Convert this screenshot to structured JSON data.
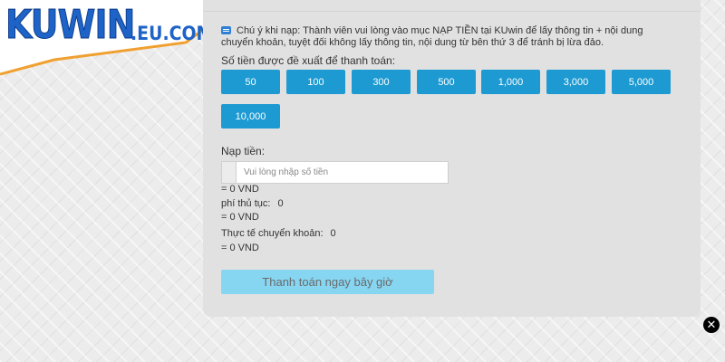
{
  "brand": {
    "name": "KUWIN",
    "suffix": ".EU.COM"
  },
  "notice": {
    "icon": "info-icon",
    "text": "Chú ý khi nạp: Thành viên vui lòng vào mục NẠP TIỀN tại KUwin để lấy thông tin + nội dung chuyển khoản, tuyệt đối không lấy thông tin, nội dung từ bên thứ 3 để tránh bị lừa đảo."
  },
  "suggested": {
    "label": "Số tiền được đề xuất để thanh toán:",
    "amounts": [
      "50",
      "100",
      "300",
      "500",
      "1,000",
      "3,000",
      "5,000",
      "10,000"
    ]
  },
  "deposit": {
    "label": "Nạp tiền:",
    "placeholder": "Vui lòng nhập số tiền",
    "value": ""
  },
  "summary": {
    "amount_vnd": "= 0 VND",
    "fee_label": "phí thủ tục:",
    "fee_value": "0",
    "fee_vnd": "= 0 VND",
    "actual_label": "Thực tế chuyển khoản:",
    "actual_value": "0",
    "actual_vnd": "= 0 VND"
  },
  "pay_button": "Thanh toán ngay bây giờ",
  "close_icon": "close-icon",
  "colors": {
    "brand_blue": "#1e63c8",
    "accent_orange": "#f0a030",
    "amount_button": "#1e9ad2",
    "pay_button": "#86d6f2",
    "panel": "#e1e1e1"
  }
}
